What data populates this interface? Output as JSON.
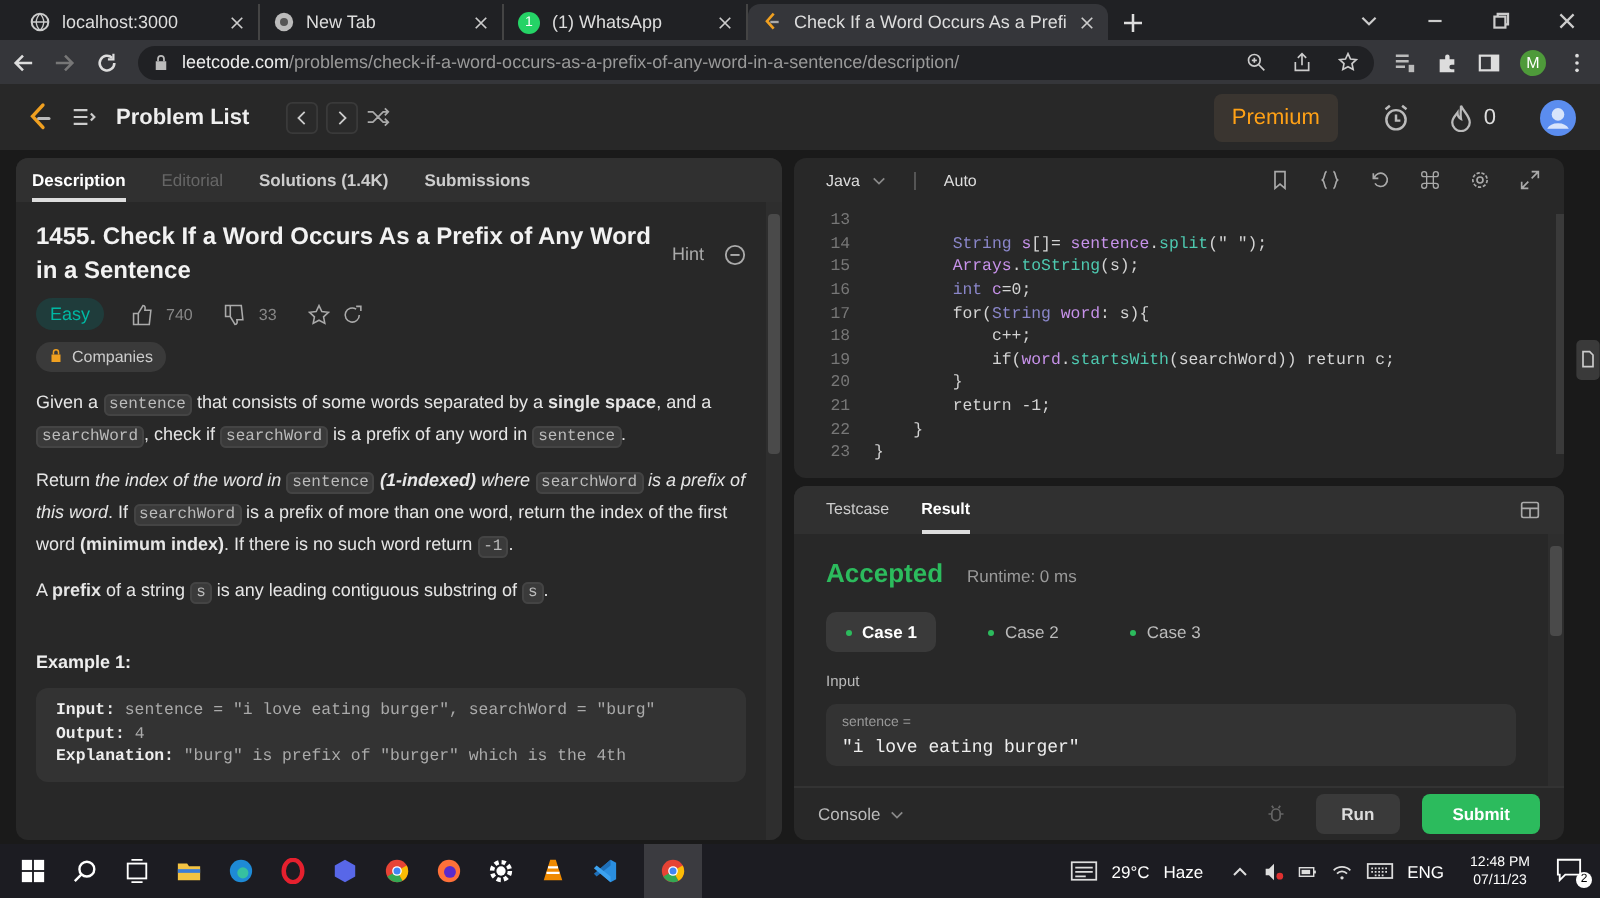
{
  "browser": {
    "tabs": [
      {
        "title": "localhost:3000",
        "selected": false
      },
      {
        "title": "New Tab",
        "selected": false
      },
      {
        "title": "(1) WhatsApp",
        "badge": "1",
        "selected": false
      },
      {
        "title": "Check If a Word Occurs As a Prefi",
        "selected": true
      }
    ],
    "url_host": "leetcode.com",
    "url_path": "/problems/check-if-a-word-occurs-as-a-prefix-of-any-word-in-a-sentence/description/",
    "profile": "M"
  },
  "nav": {
    "problem_list": "Problem List",
    "premium": "Premium",
    "streak": "0"
  },
  "description": {
    "tabs": [
      {
        "label": "Description",
        "selected": true,
        "disabled": false
      },
      {
        "label": "Editorial",
        "selected": false,
        "disabled": true
      },
      {
        "label": "Solutions (1.4K)",
        "selected": false,
        "disabled": false
      },
      {
        "label": "Submissions",
        "selected": false,
        "disabled": false
      }
    ],
    "title": "1455. Check If a Word Occurs As a Prefix of Any Word in a Sentence",
    "hint": "Hint",
    "difficulty": "Easy",
    "likes": "740",
    "dislikes": "33",
    "companies": "Companies",
    "paragraphs": [
      [
        {
          "kind": "text",
          "text": "Given a "
        },
        {
          "kind": "code",
          "text": "sentence"
        },
        {
          "kind": "text",
          "text": " that consists of some words separated by a **single space**, and a "
        },
        {
          "kind": "code",
          "text": "searchWord"
        },
        {
          "kind": "text",
          "text": ", check if "
        },
        {
          "kind": "code",
          "text": "searchWord"
        },
        {
          "kind": "text",
          "text": " is a prefix of any word in "
        },
        {
          "kind": "code",
          "text": "sentence"
        },
        {
          "kind": "text",
          "text": "."
        }
      ],
      [
        {
          "kind": "text",
          "text": "Return "
        },
        {
          "kind": "em",
          "text": "the index of the word in "
        },
        {
          "kind": "code",
          "text": "sentence"
        },
        {
          "kind": "em",
          "text": " **(1-indexed)** where "
        },
        {
          "kind": "code",
          "text": "searchWord"
        },
        {
          "kind": "em",
          "text": " is a prefix of this word"
        },
        {
          "kind": "text",
          "text": ". If "
        },
        {
          "kind": "code",
          "text": "searchWord"
        },
        {
          "kind": "text",
          "text": " is a prefix of more than one word, return the index of the first word **(minimum index)**. If there is no such word return "
        },
        {
          "kind": "code",
          "text": "-1"
        },
        {
          "kind": "text",
          "text": "."
        }
      ],
      [
        {
          "kind": "text",
          "text": "A **prefix** of a string "
        },
        {
          "kind": "code",
          "text": "s"
        },
        {
          "kind": "text",
          "text": " is any leading contiguous substring of "
        },
        {
          "kind": "code",
          "text": "s"
        },
        {
          "kind": "text",
          "text": "."
        }
      ]
    ],
    "example_heading": "Example 1:",
    "example_lines": [
      {
        "label": "Input:",
        "value": "sentence = \"i love eating burger\", searchWord = \"burg\""
      },
      {
        "label": "Output:",
        "value": "4"
      },
      {
        "label": "Explanation:",
        "value": "\"burg\" is prefix of \"burger\" which is the 4th"
      }
    ]
  },
  "editor": {
    "language": "Java",
    "mode": "Auto",
    "lines": [
      {
        "number": "13"
      },
      {
        "number": "14",
        "tokens": [
          {
            "kind": "type",
            "text": "        String"
          },
          {
            "kind": "var",
            "text": " s"
          },
          {
            "kind": "plain",
            "text": "[]= "
          },
          {
            "kind": "var",
            "text": "sentence"
          },
          {
            "kind": "plain",
            "text": "."
          },
          {
            "kind": "fn",
            "text": "split"
          },
          {
            "kind": "plain",
            "text": "(\" \");"
          }
        ]
      },
      {
        "number": "15",
        "tokens": [
          {
            "kind": "var",
            "text": "        Arrays"
          },
          {
            "kind": "plain",
            "text": "."
          },
          {
            "kind": "fn",
            "text": "toString"
          },
          {
            "kind": "plain",
            "text": "(s);"
          }
        ]
      },
      {
        "number": "16",
        "tokens": [
          {
            "kind": "type",
            "text": "        int"
          },
          {
            "kind": "var",
            "text": " c"
          },
          {
            "kind": "plain",
            "text": "=0;"
          }
        ]
      },
      {
        "number": "17",
        "tokens": [
          {
            "kind": "plain",
            "text": "        for("
          },
          {
            "kind": "type",
            "text": "String"
          },
          {
            "kind": "var",
            "text": " word"
          },
          {
            "kind": "plain",
            "text": ": s){"
          }
        ]
      },
      {
        "number": "18",
        "tokens": [
          {
            "kind": "plain",
            "text": "            c++;"
          }
        ]
      },
      {
        "number": "19",
        "tokens": [
          {
            "kind": "plain",
            "text": "            if("
          },
          {
            "kind": "var",
            "text": "word"
          },
          {
            "kind": "plain",
            "text": "."
          },
          {
            "kind": "fn",
            "text": "startsWith"
          },
          {
            "kind": "plain",
            "text": "(searchWord)) return c;"
          }
        ]
      },
      {
        "number": "20",
        "tokens": [
          {
            "kind": "plain",
            "text": "        }"
          }
        ]
      },
      {
        "number": "21",
        "tokens": [
          {
            "kind": "plain",
            "text": "        return -1;"
          }
        ]
      },
      {
        "number": "22",
        "tokens": [
          {
            "kind": "plain",
            "text": "    }"
          }
        ]
      },
      {
        "number": "23",
        "tokens": [
          {
            "kind": "plain",
            "text": "}"
          }
        ]
      }
    ]
  },
  "result": {
    "tabs": [
      {
        "label": "Testcase",
        "selected": false
      },
      {
        "label": "Result",
        "selected": true
      }
    ],
    "status": "Accepted",
    "runtime": "Runtime: 0 ms",
    "cases": [
      {
        "label": "Case 1",
        "selected": true
      },
      {
        "label": "Case 2",
        "selected": false
      },
      {
        "label": "Case 3",
        "selected": false
      }
    ],
    "input_label": "Input",
    "param_name": "sentence =",
    "param_value": "\"i love eating burger\"",
    "console": "Console",
    "run": "Run",
    "submit": "Submit"
  },
  "taskbar": {
    "temperature": "29°C",
    "weather": "Haze",
    "language": "ENG",
    "time": "12:48 PM",
    "date": "07/11/23",
    "notifications": "2"
  }
}
